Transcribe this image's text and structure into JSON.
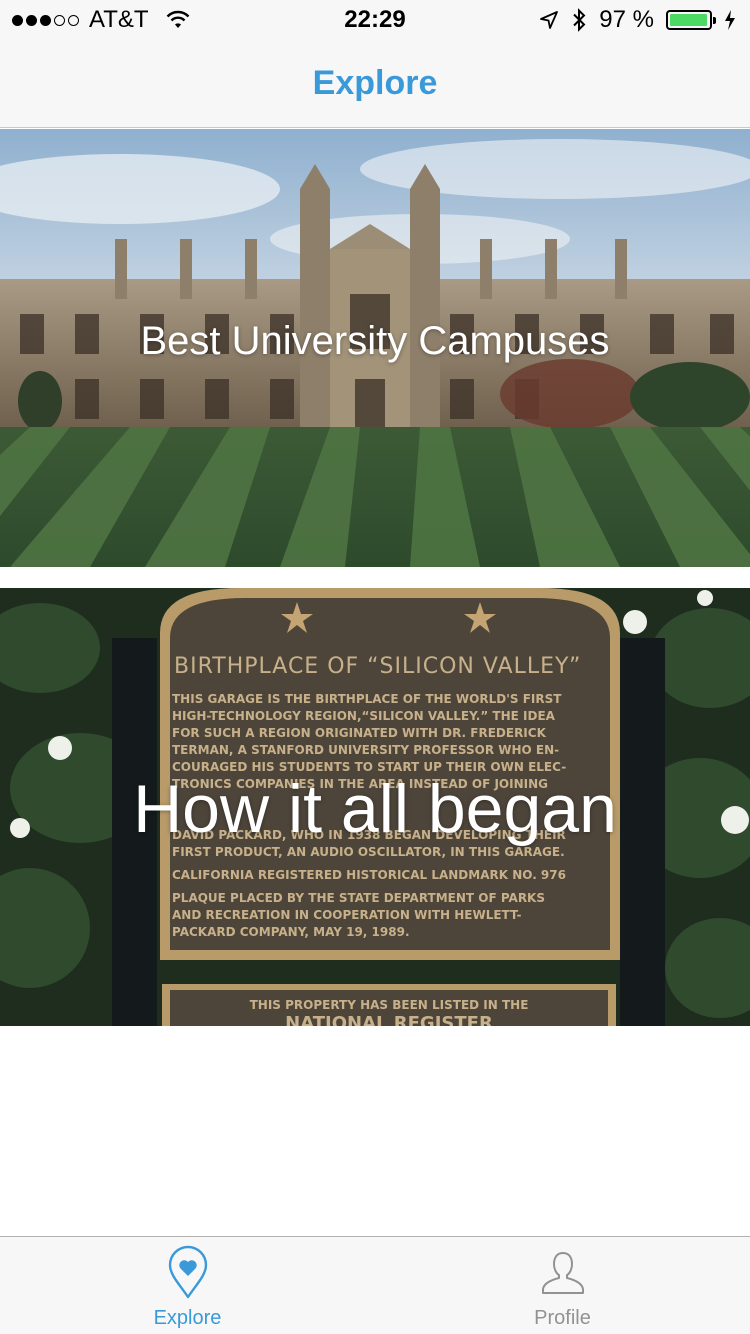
{
  "status_bar": {
    "carrier": "AT&T",
    "time": "22:29",
    "battery_percent": "97 %",
    "battery_level": 0.97,
    "signal_bars_filled": 3,
    "signal_bars_total": 5
  },
  "nav": {
    "title": "Explore"
  },
  "cards": [
    {
      "title": "Best University Campuses",
      "image": "university-campus-photo"
    },
    {
      "title": "How it all began",
      "image": "silicon-valley-plaque-photo"
    }
  ],
  "plaque": {
    "heading": "BIRTHPLACE OF “SILICON VALLEY”",
    "lines": [
      "THIS GARAGE IS THE BIRTHPLACE OF THE WORLD'S FIRST",
      "HIGH-TECHNOLOGY REGION,“SILICON VALLEY.” THE IDEA",
      "FOR SUCH A REGION ORIGINATED WITH DR. FREDERICK",
      "TERMAN, A STANFORD UNIVERSITY PROFESSOR WHO EN-",
      "COURAGED HIS STUDENTS TO START UP THEIR OWN ELEC-",
      "TRONICS COMPANIES IN THE AREA INSTEAD OF JOINING",
      "DAVID PACKARD, WHO IN 1938 BEGAN DEVELOPING THEIR",
      "FIRST PRODUCT, AN AUDIO OSCILLATOR, IN THIS GARAGE.",
      "CALIFORNIA REGISTERED HISTORICAL LANDMARK NO. 976",
      "PLAQUE PLACED BY THE STATE DEPARTMENT OF PARKS",
      "AND RECREATION IN COOPERATION WITH HEWLETT-",
      "PACKARD COMPANY, MAY 19, 1989."
    ],
    "lower_sign": "THIS PROPERTY HAS BEEN LISTED IN THE",
    "lower_sign_2": "NATIONAL REGISTER"
  },
  "tabs": [
    {
      "label": "Explore",
      "icon": "location-heart-icon",
      "active": true
    },
    {
      "label": "Profile",
      "icon": "person-icon",
      "active": false
    }
  ],
  "colors": {
    "accent": "#3a9ad9",
    "inactive": "#929292",
    "battery": "#4cd964"
  }
}
